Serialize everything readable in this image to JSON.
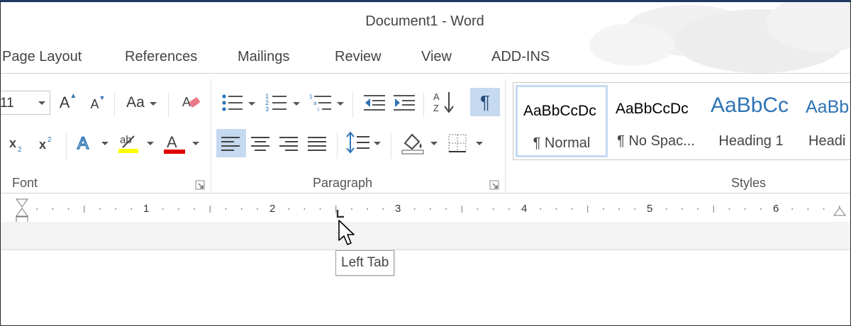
{
  "window": {
    "title": "Document1 - Word"
  },
  "tabs": [
    "Page Layout",
    "References",
    "Mailings",
    "Review",
    "View",
    "ADD-INS"
  ],
  "font_group": {
    "label": "Font",
    "font_size": "11",
    "icons": [
      "grow-font-icon",
      "shrink-font-icon",
      "change-case-icon",
      "clear-formatting-icon",
      "subscript-icon",
      "superscript-icon",
      "text-effects-icon",
      "highlight-icon",
      "font-color-icon"
    ],
    "change_case_text": "Aa",
    "highlight_color": "#ffff00",
    "font_color": "#e00000"
  },
  "paragraph_group": {
    "label": "Paragraph",
    "icons": [
      "bullets-icon",
      "numbering-icon",
      "multilevel-list-icon",
      "decrease-indent-icon",
      "increase-indent-icon",
      "sort-icon",
      "show-hide-icon",
      "align-left-icon",
      "center-icon",
      "align-right-icon",
      "justify-icon",
      "line-spacing-icon",
      "shading-icon",
      "borders-icon"
    ],
    "show_formatting_symbol": "¶",
    "active": [
      "show-hide",
      "align-left"
    ]
  },
  "styles_group": {
    "label": "Styles",
    "items": [
      {
        "preview": "AaBbCcDc",
        "name": "¶ Normal",
        "color": "#000000",
        "selected": true
      },
      {
        "preview": "AaBbCcDc",
        "name": "¶ No Spac...",
        "color": "#000000",
        "selected": false
      },
      {
        "preview": "AaBbCc",
        "name": "Heading 1",
        "color": "#2e74b5",
        "selected": false
      },
      {
        "preview": "AaBb",
        "name": "Headi",
        "color": "#2e74b5",
        "selected": false
      }
    ]
  },
  "ruler": {
    "numbers": [
      "1",
      "2",
      "3",
      "4",
      "5",
      "6"
    ],
    "unit": "inch"
  },
  "tooltip": {
    "text": "Left Tab"
  },
  "colors": {
    "accent_selected": "#c5d9f1",
    "heading_blue": "#2e74b5",
    "title_bar_border": "#1f3864"
  }
}
